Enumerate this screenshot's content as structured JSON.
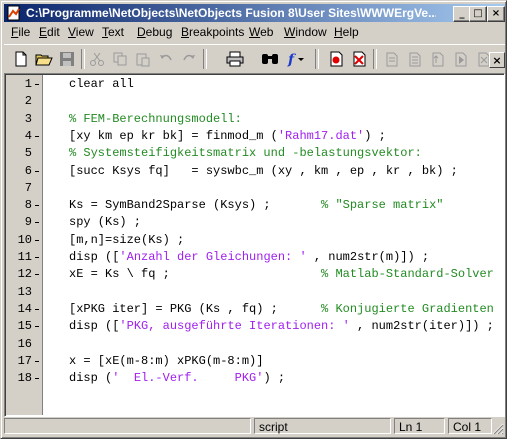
{
  "window": {
    "title": "C:\\Programme\\NetObjects\\NetObjects Fusion 8\\User Sites\\WWWErgVe...",
    "controls": {
      "minimize": "_",
      "maximize": "□",
      "close": "×"
    }
  },
  "menu": [
    {
      "label": "File",
      "u": "F",
      "rest": "ile"
    },
    {
      "label": "Edit",
      "u": "E",
      "rest": "dit"
    },
    {
      "label": "View",
      "u": "V",
      "rest": "iew"
    },
    {
      "label": "Text",
      "u": "T",
      "rest": "ext"
    },
    {
      "label": "Debug",
      "u": "D",
      "rest": "ebug"
    },
    {
      "label": "Breakpoints",
      "u": "B",
      "rest": "reakpoints"
    },
    {
      "label": "Web",
      "u": "W",
      "rest": "eb"
    },
    {
      "label": "Window",
      "u": "W",
      "rest": "indow"
    },
    {
      "label": "Help",
      "u": "H",
      "rest": "elp"
    }
  ],
  "toolbar": {
    "buttons": [
      "new-file-icon",
      "open-folder-icon",
      "save-icon",
      "cut-icon",
      "copy-icon",
      "paste-icon",
      "undo-icon",
      "redo-icon",
      "print-icon",
      "find-icon",
      "function-icon",
      "set-breakpoint-icon",
      "clear-breakpoint-icon",
      "step-in-icon",
      "step-icon",
      "step-out-icon",
      "continue-icon",
      "exit-debug-icon"
    ],
    "dock_close": "×"
  },
  "editor": {
    "lines": [
      {
        "n": "1",
        "dash": true,
        "parts": [
          {
            "t": "clear all",
            "c": ""
          }
        ]
      },
      {
        "n": "2",
        "dash": false,
        "parts": []
      },
      {
        "n": "3",
        "dash": false,
        "parts": [
          {
            "t": "% FEM-Berechnungsmodell:",
            "c": "cmt"
          }
        ]
      },
      {
        "n": "4",
        "dash": true,
        "parts": [
          {
            "t": "[xy km ep kr bk] = finmod_m (",
            "c": ""
          },
          {
            "t": "'Rahm17.dat'",
            "c": "str"
          },
          {
            "t": ") ;",
            "c": ""
          }
        ]
      },
      {
        "n": "5",
        "dash": false,
        "parts": [
          {
            "t": "% Systemsteifigkeitsmatrix und -belastungsvektor:",
            "c": "cmt"
          }
        ]
      },
      {
        "n": "6",
        "dash": true,
        "parts": [
          {
            "t": "[succ Ksys fq]   = syswbc_m (xy , km , ep , kr , bk) ;",
            "c": ""
          }
        ]
      },
      {
        "n": "7",
        "dash": false,
        "parts": []
      },
      {
        "n": "8",
        "dash": true,
        "parts": [
          {
            "t": "Ks = SymBand2Sparse (Ksys) ;       ",
            "c": ""
          },
          {
            "t": "% \"Sparse matrix\"",
            "c": "cmt"
          }
        ]
      },
      {
        "n": "9",
        "dash": true,
        "parts": [
          {
            "t": "spy (Ks) ;",
            "c": ""
          }
        ]
      },
      {
        "n": "10",
        "dash": true,
        "parts": [
          {
            "t": "[m,n]=size(Ks) ;",
            "c": ""
          }
        ]
      },
      {
        "n": "11",
        "dash": true,
        "parts": [
          {
            "t": "disp ([",
            "c": ""
          },
          {
            "t": "'Anzahl der Gleichungen: '",
            "c": "str"
          },
          {
            "t": " , num2str(m)]) ;",
            "c": ""
          }
        ]
      },
      {
        "n": "12",
        "dash": true,
        "parts": [
          {
            "t": "xE = Ks \\ fq ;                     ",
            "c": ""
          },
          {
            "t": "% Matlab-Standard-Solver",
            "c": "cmt"
          }
        ]
      },
      {
        "n": "13",
        "dash": false,
        "parts": []
      },
      {
        "n": "14",
        "dash": true,
        "parts": [
          {
            "t": "[xPKG iter] = PKG (Ks , fq) ;      ",
            "c": ""
          },
          {
            "t": "% Konjugierte Gradienten",
            "c": "cmt"
          }
        ]
      },
      {
        "n": "15",
        "dash": true,
        "parts": [
          {
            "t": "disp ([",
            "c": ""
          },
          {
            "t": "'PKG, ausgeführte Iterationen: '",
            "c": "str"
          },
          {
            "t": " , num2str(iter)]) ;",
            "c": ""
          }
        ]
      },
      {
        "n": "16",
        "dash": false,
        "parts": []
      },
      {
        "n": "17",
        "dash": true,
        "parts": [
          {
            "t": "x = [xE(m-8:m) xPKG(m-8:m)]",
            "c": ""
          }
        ]
      },
      {
        "n": "18",
        "dash": true,
        "parts": [
          {
            "t": "disp (",
            "c": ""
          },
          {
            "t": "'  El.-Verf.     PKG'",
            "c": "str"
          },
          {
            "t": ") ;",
            "c": ""
          }
        ]
      }
    ]
  },
  "statusbar": {
    "mode": "script",
    "line": "Ln 1",
    "col": "Col 1"
  }
}
